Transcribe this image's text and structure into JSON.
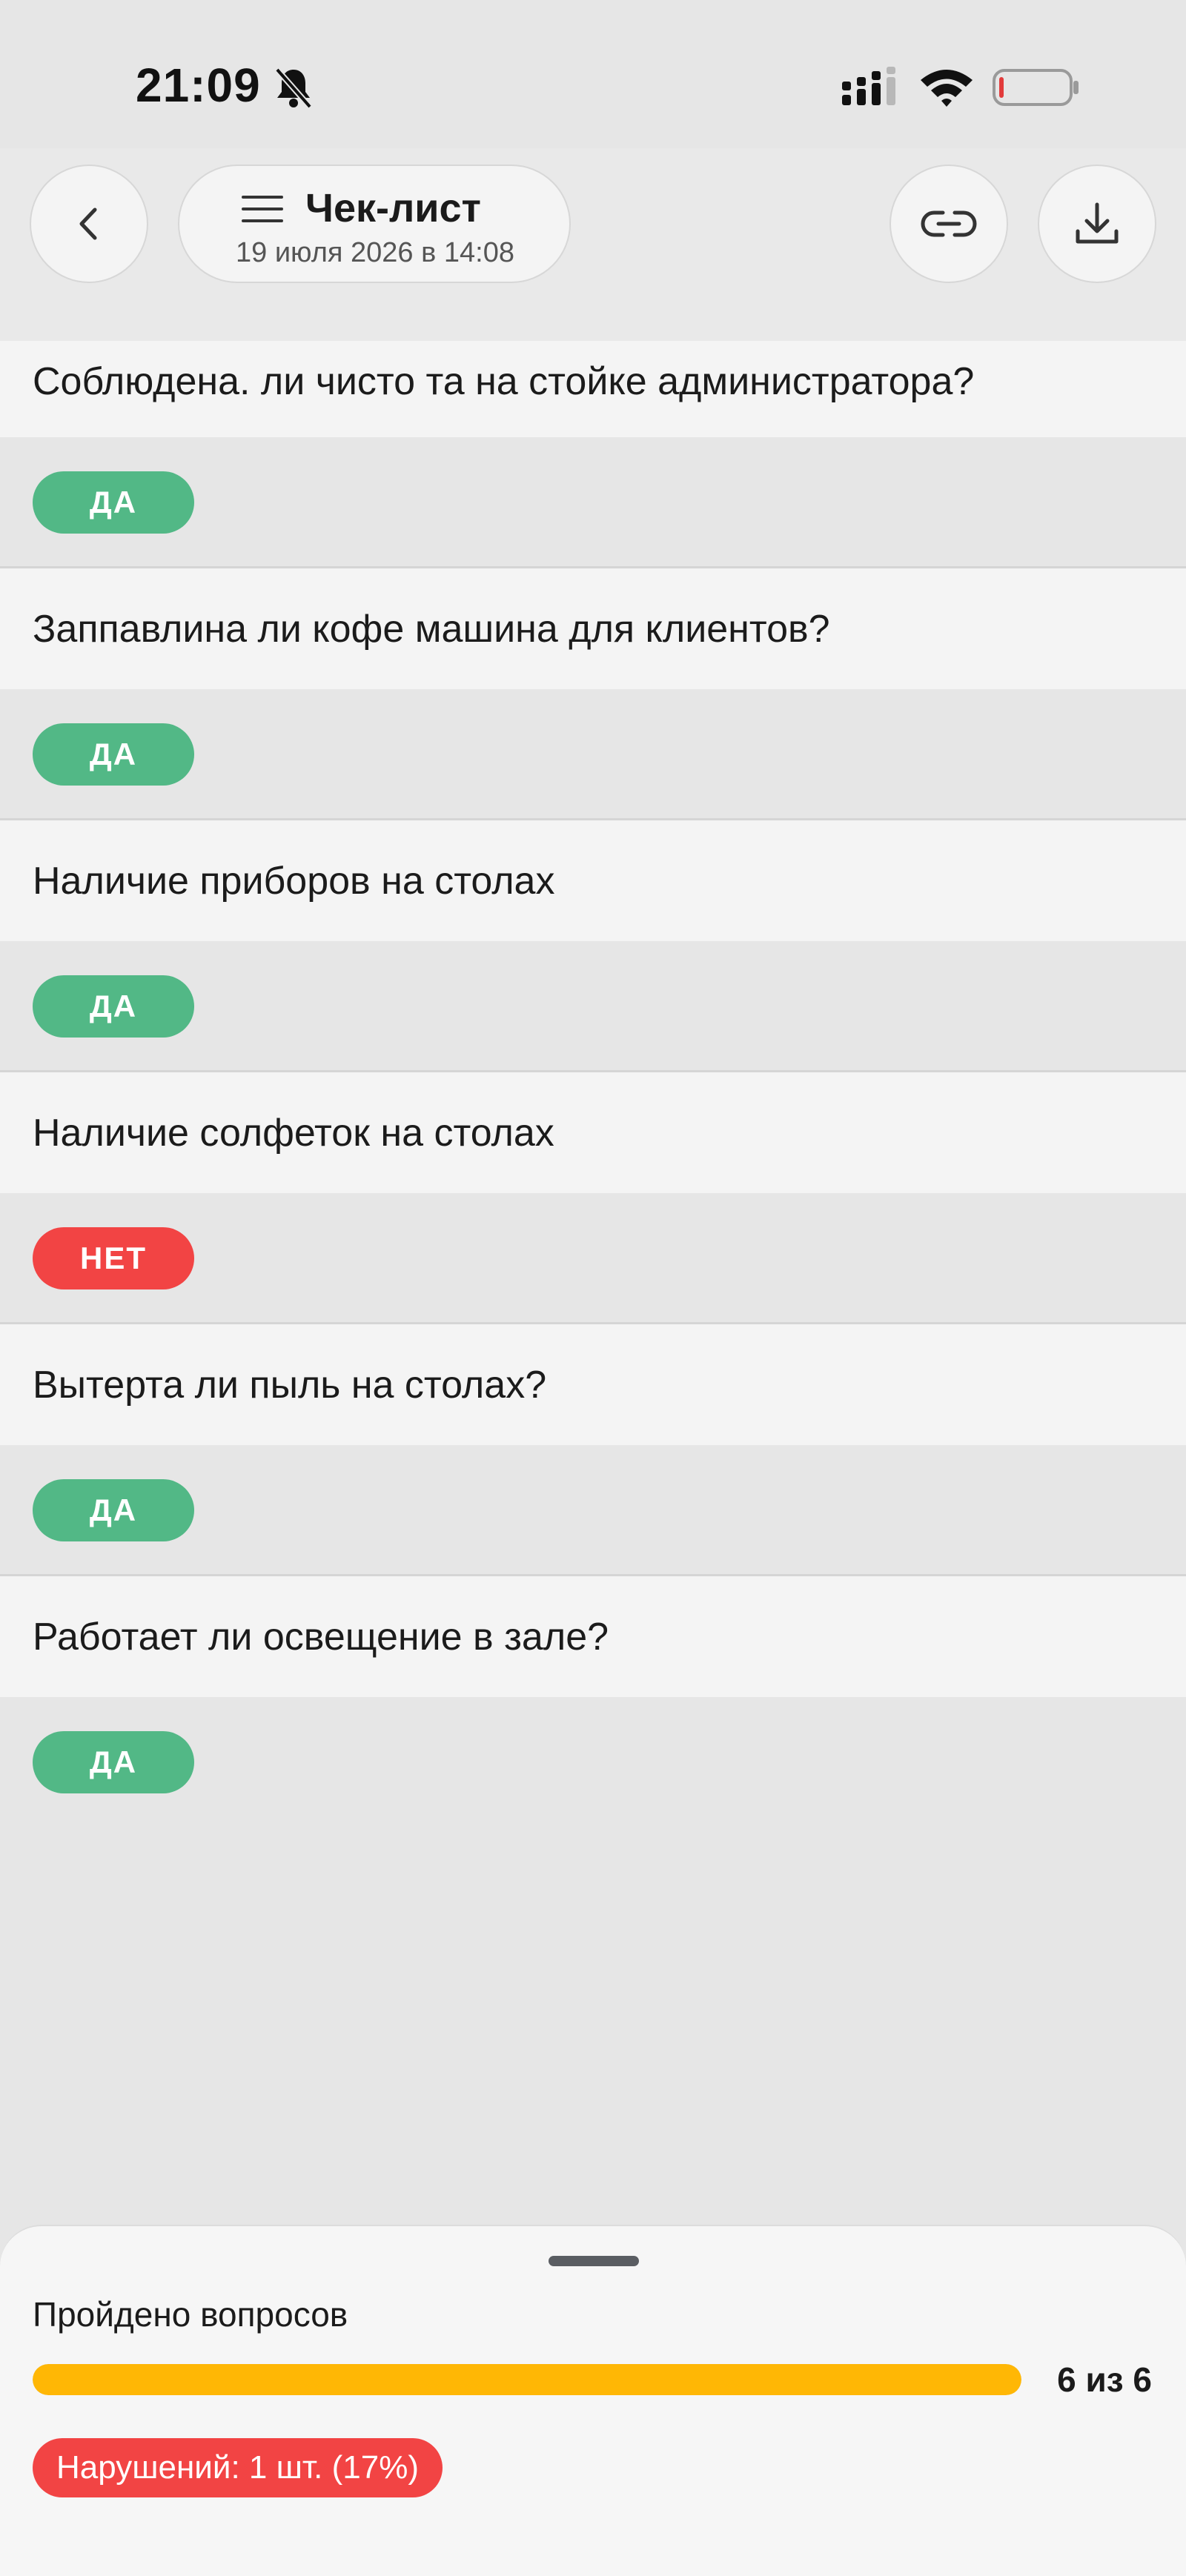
{
  "status_bar": {
    "time": "21:09"
  },
  "header": {
    "title": "Чек-лист",
    "subtitle": "19 июля 2026 в 14:08"
  },
  "questions": [
    {
      "text": "Соблюдена. ли чисто та на стойке администратора?",
      "answer": "ДА",
      "status": "yes"
    },
    {
      "text": "Заппавлина ли кофе машина для клиентов?",
      "answer": "ДА",
      "status": "yes"
    },
    {
      "text": "Наличие приборов на столах",
      "answer": "ДА",
      "status": "yes"
    },
    {
      "text": "Наличие солфеток на столах",
      "answer": "НЕТ",
      "status": "no"
    },
    {
      "text": "Вытерта ли пыль на столах?",
      "answer": "ДА",
      "status": "yes"
    },
    {
      "text": "Работает ли освещение в зале?",
      "answer": "ДА",
      "status": "yes"
    }
  ],
  "summary": {
    "progress_label": "Пройдено вопросов",
    "progress_count": "6 из 6",
    "progress_fraction": 1.0,
    "violations": "Нарушений: 1 шт. (17%)"
  },
  "colors": {
    "yes": "#52b886",
    "no": "#f24444",
    "progress": "#ffb705",
    "violations": "#f24444"
  },
  "icons": {
    "back": "chevron-left-icon",
    "menu": "menu-icon",
    "link": "link-icon",
    "download": "download-icon",
    "bell_off": "bell-off-icon",
    "signal": "signal-icon",
    "wifi": "wifi-icon",
    "battery": "battery-icon"
  }
}
